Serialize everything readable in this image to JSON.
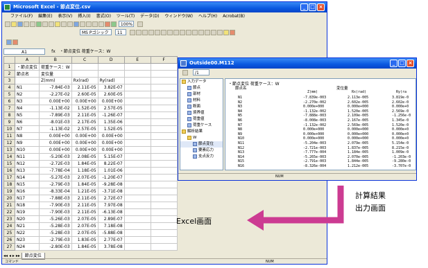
{
  "excel": {
    "title": "Microsoft Excel - 節点変位.csv",
    "menu": [
      "ファイル(F)",
      "編集(E)",
      "表示(V)",
      "挿入(I)",
      "書式(O)",
      "ツール(T)",
      "データ(D)",
      "ウィンドウ(W)",
      "ヘルプ(H)",
      "Acrobat(B)"
    ],
    "font_name": "MS Pゴシック",
    "font_size": "11",
    "zoom": "100%",
    "cell_ref": "A1",
    "formula": "・節点変位  荷重ケース：W",
    "columns": [
      "A",
      "B",
      "C",
      "D",
      "E",
      "F"
    ],
    "rows": [
      {
        "n": "1",
        "a": "・節点変位",
        "b": "荷重ケース：W",
        "c": "",
        "d": ""
      },
      {
        "n": "2",
        "a": "節点名",
        "b": "変位量",
        "c": "",
        "d": ""
      },
      {
        "n": "3",
        "a": "",
        "b": "Z(mm)",
        "c": "Rx(rad)",
        "d": "Ry(rad)"
      },
      {
        "n": "4",
        "a": "N1",
        "b": "-7.84E-03",
        "c": "2.11E-05",
        "d": "3.82E-07"
      },
      {
        "n": "5",
        "a": "N2",
        "c": "2.60E-05",
        "b": "-2.27E-02",
        "d": "2.60E-05"
      },
      {
        "n": "6",
        "a": "N3",
        "b": "0.00E+00",
        "c": "0.00E+00",
        "d": "0.00E+00"
      },
      {
        "n": "7",
        "a": "N4",
        "b": "-1.13E-02",
        "c": "1.52E-05",
        "d": "2.57E-05"
      },
      {
        "n": "8",
        "a": "N5",
        "b": "-7.89E-03",
        "c": "2.11E-05",
        "d": "-1.26E-07"
      },
      {
        "n": "9",
        "a": "N6",
        "b": "-8.01E-03",
        "c": "2.17E-05",
        "d": "1.35E-06"
      },
      {
        "n": "10",
        "a": "N7",
        "b": "-1.13E-02",
        "c": "2.57E-05",
        "d": "1.52E-05"
      },
      {
        "n": "11",
        "a": "N8",
        "b": "0.00E+00",
        "c": "0.00E+00",
        "d": "0.00E+00"
      },
      {
        "n": "12",
        "a": "N9",
        "b": "0.00E+00",
        "c": "0.00E+00",
        "d": "0.00E+00"
      },
      {
        "n": "13",
        "a": "N10",
        "b": "0.00E+00",
        "c": "0.00E+00",
        "d": "0.00E+00"
      },
      {
        "n": "14",
        "a": "N11",
        "b": "-5.20E-03",
        "c": "2.08E-05",
        "d": "5.15E-07"
      },
      {
        "n": "15",
        "a": "N12",
        "b": "-2.72E-03",
        "c": "1.84E-05",
        "d": "8.22E-07"
      },
      {
        "n": "16",
        "a": "N13",
        "b": "-7.78E-04",
        "c": "1.18E-05",
        "d": "1.01E-06"
      },
      {
        "n": "17",
        "a": "N14",
        "b": "-5.27E-03",
        "c": "2.07E-05",
        "d": "-1.20E-07"
      },
      {
        "n": "18",
        "a": "N15",
        "b": "-2.79E-03",
        "c": "1.84E-05",
        "d": "-9.28E-08"
      },
      {
        "n": "19",
        "a": "N16",
        "b": "-8.33E-04",
        "c": "1.21E-05",
        "d": "-3.71E-08"
      },
      {
        "n": "20",
        "a": "N17",
        "b": "-7.88E-03",
        "c": "2.11E-05",
        "d": "2.72E-07"
      },
      {
        "n": "21",
        "a": "N18",
        "b": "-7.90E-03",
        "c": "2.11E-05",
        "d": "7.97E-08"
      },
      {
        "n": "22",
        "a": "N19",
        "b": "-7.90E-03",
        "c": "2.11E-05",
        "d": "-6.13E-08"
      },
      {
        "n": "23",
        "a": "N20",
        "b": "-5.26E-03",
        "c": "2.07E-05",
        "d": "2.89E-07"
      },
      {
        "n": "24",
        "a": "N21",
        "b": "-5.28E-03",
        "c": "2.07E-05",
        "d": "7.18E-08"
      },
      {
        "n": "25",
        "a": "N22",
        "b": "-5.28E-03",
        "c": "2.07E-05",
        "d": "-5.88E-08"
      },
      {
        "n": "26",
        "a": "N23",
        "b": "-2.79E-03",
        "c": "1.83E-05",
        "d": "2.77E-07"
      },
      {
        "n": "27",
        "a": "N24",
        "b": "-2.80E-03",
        "c": "1.84E-05",
        "d": "3.78E-08"
      }
    ],
    "sheet_tab": "節点変位",
    "status_left": "コマンド",
    "status_right": "NUM"
  },
  "outsw": {
    "title": "Outside00.M112",
    "page_field": "/1",
    "tree": [
      {
        "label": "入力データ",
        "level": 0,
        "folder": true
      },
      {
        "label": "節点",
        "level": 1
      },
      {
        "label": "部材",
        "level": 1
      },
      {
        "label": "材料",
        "level": 1
      },
      {
        "label": "断面",
        "level": 1
      },
      {
        "label": "境界値",
        "level": 1
      },
      {
        "label": "荷重値",
        "level": 1
      },
      {
        "label": "荷重ケース",
        "level": 1
      },
      {
        "label": "解析結果",
        "level": 0,
        "folder": true
      },
      {
        "label": "W",
        "level": 1,
        "folder": true
      },
      {
        "label": "節点変位",
        "level": 2,
        "selected": true
      },
      {
        "label": "要素応力",
        "level": 2
      },
      {
        "label": "支点反力",
        "level": 2
      }
    ],
    "result_heading": "・節点変位  荷重ケース：W",
    "result_sub": "節点名",
    "result_group": "変位量",
    "result_cols": [
      "Z(mm)",
      "Rx(rad)",
      "Ry(ra"
    ],
    "result_rows": [
      [
        "N1",
        "-7.839e-003",
        "2.113e-005",
        "3.819e-0"
      ],
      [
        "N2",
        "-2.270e-002",
        "2.602e-005",
        "2.602e-0"
      ],
      [
        "N3",
        "0.000e+000",
        "0.000e+000",
        "0.000e+0"
      ],
      [
        "N4",
        "-1.132e-002",
        "1.520e-005",
        "2.569e-0"
      ],
      [
        "N5",
        "-7.888e-003",
        "2.109e-005",
        "-1.256e-0"
      ],
      [
        "N6",
        "-8.008e-003",
        "2.167e-005",
        "1.345e-0"
      ],
      [
        "N7",
        "-1.132e-002",
        "2.569e-005",
        "1.520e-0"
      ],
      [
        "N8",
        "0.000e+000",
        "0.000e+000",
        "0.000e+0"
      ],
      [
        "N9",
        "0.000e+000",
        "0.000e+000",
        "0.000e+0"
      ],
      [
        "N10",
        "0.000e+000",
        "0.000e+000",
        "0.000e+0"
      ],
      [
        "N11",
        "-5.204e-003",
        "2.079e-005",
        "5.154e-0"
      ],
      [
        "N12",
        "-2.721e-003",
        "1.837e-005",
        "8.215e-0"
      ],
      [
        "N13",
        "-7.777e-004",
        "1.184e-005",
        "1.009e-0"
      ],
      [
        "N14",
        "-5.265e-003",
        "2.070e-005",
        "-1.203e-0"
      ],
      [
        "N15",
        "-2.791e-003",
        "1.844e-005",
        "-9.280e-0"
      ],
      [
        "N16",
        "-8.326e-004",
        "1.212e-005",
        "-3.707e-0"
      ]
    ],
    "status_right": "NUM"
  },
  "callouts": {
    "excel_label": "Excel画面",
    "result_label_1": "計算結果",
    "result_label_2": "出力画面"
  },
  "colors": {
    "arrow": "#cc3b92",
    "titlebar": "#0a58e0"
  }
}
